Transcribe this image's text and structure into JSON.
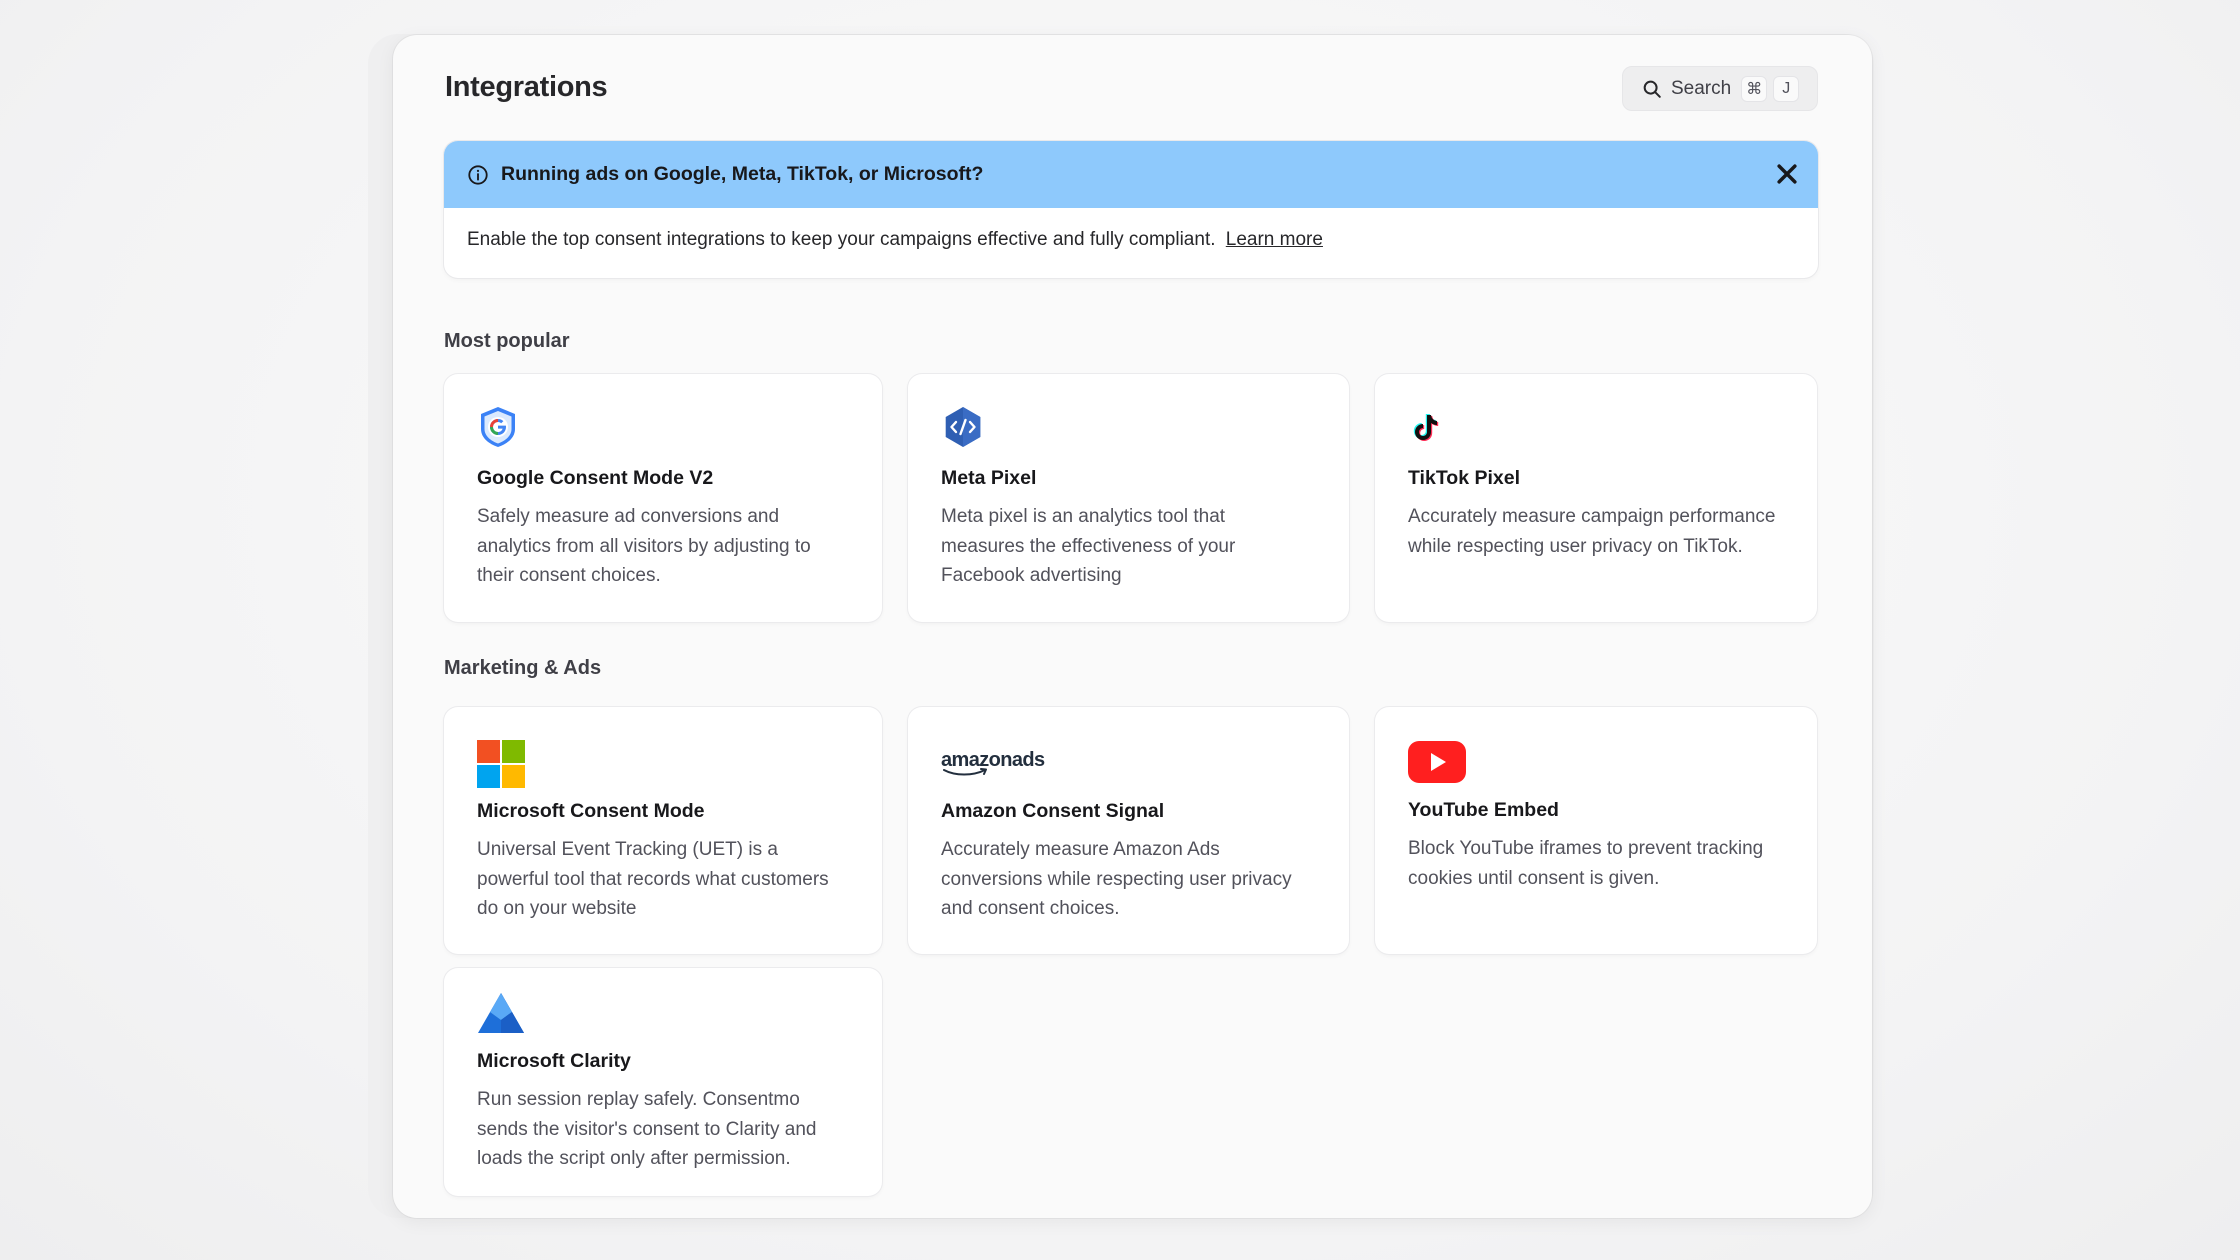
{
  "header": {
    "title": "Integrations",
    "search_label": "Search",
    "shortcut_cmd": "⌘",
    "shortcut_key": "J"
  },
  "banner": {
    "title": "Running ads on Google, Meta, TikTok, or Microsoft?",
    "body": "Enable the top consent integrations to keep your campaigns effective and fully compliant.",
    "link": "Learn more",
    "header_color": "#8ec9fc"
  },
  "sections": {
    "popular": {
      "title": "Most popular",
      "cards": [
        {
          "name": "Google Consent Mode V2",
          "icon": "google-shield-icon",
          "desc": "Safely measure ad conversions and analytics from all visitors by adjusting to their consent choices."
        },
        {
          "name": "Meta Pixel",
          "icon": "code-hexagon-icon",
          "desc": "Meta pixel is an analytics tool that measures the effectiveness of your Facebook advertising"
        },
        {
          "name": "TikTok Pixel",
          "icon": "tiktok-icon",
          "desc": "Accurately measure campaign performance while respecting user privacy on TikTok."
        }
      ]
    },
    "marketing": {
      "title": "Marketing & Ads",
      "cards": [
        {
          "name": "Microsoft Consent Mode",
          "icon": "microsoft-icon",
          "desc": "Universal Event Tracking (UET) is a powerful tool that records what customers do on your website"
        },
        {
          "name": "Amazon Consent Signal",
          "icon": "amazon-ads-logo",
          "logo_text": "amazonads",
          "desc": "Accurately measure Amazon Ads conversions while respecting user privacy and consent choices."
        },
        {
          "name": "YouTube Embed",
          "icon": "youtube-icon",
          "desc": "Block YouTube iframes to prevent tracking cookies until consent is given."
        },
        {
          "name": "Microsoft Clarity",
          "icon": "clarity-icon",
          "desc": "Run session replay safely. Consentmo sends the visitor's consent to Clarity and loads the script only after permission."
        }
      ]
    }
  }
}
